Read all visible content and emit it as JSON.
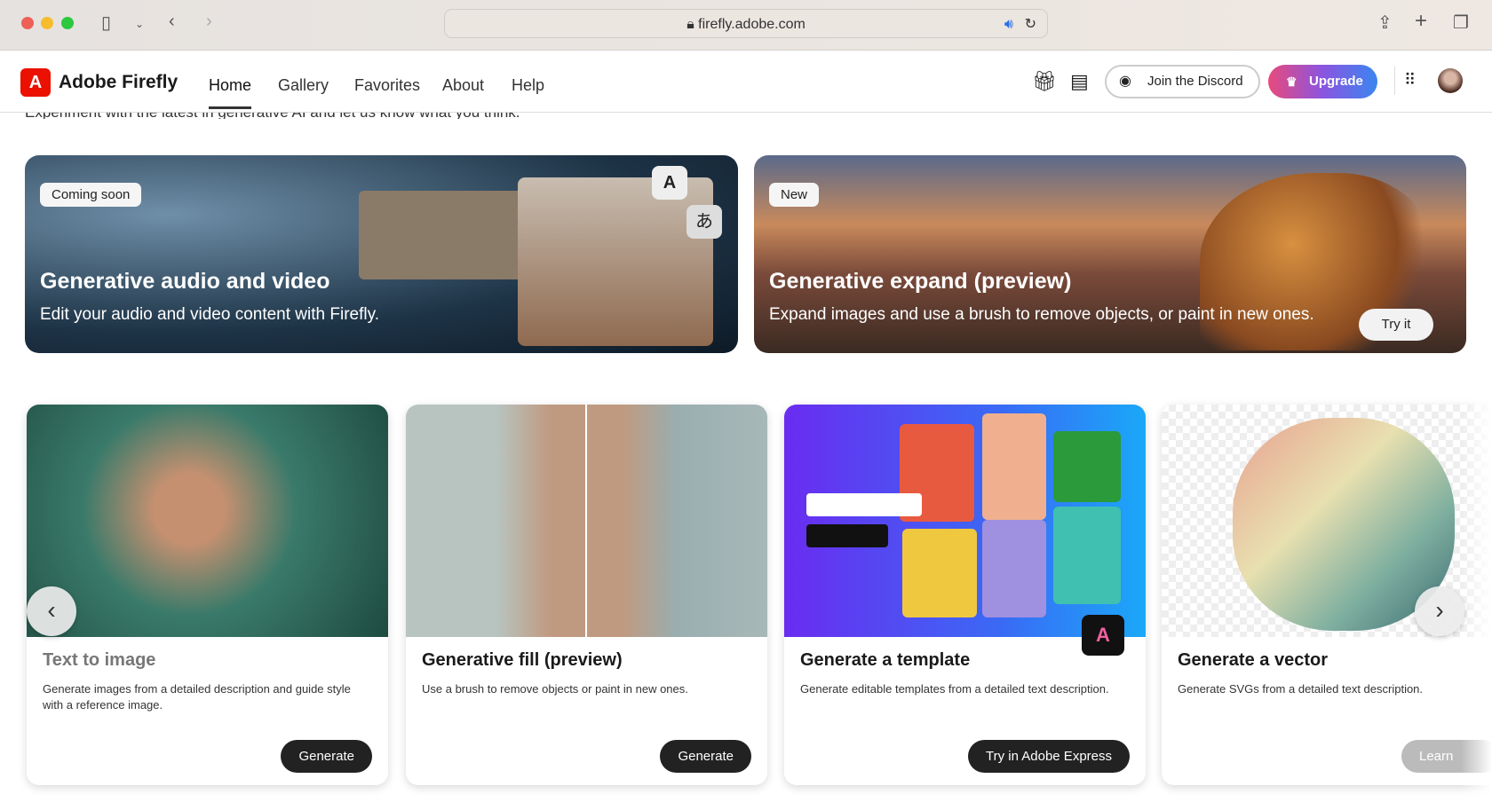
{
  "browser": {
    "url": "firefly.adobe.com"
  },
  "header": {
    "brand": "Adobe Firefly",
    "nav": [
      "Home",
      "Gallery",
      "Favorites",
      "About",
      "Help"
    ],
    "active": "Home",
    "discord": "Join the Discord",
    "upgrade": "Upgrade"
  },
  "intro": "Experiment with the latest in generative AI and let us know what you think.",
  "banners": [
    {
      "badge": "Coming soon",
      "title": "Generative audio and video",
      "desc": "Edit your audio and video content with Firefly."
    },
    {
      "badge": "New",
      "title": "Generative expand (preview)",
      "desc": "Expand images and use a brush to remove objects, or paint in new ones.",
      "button": "Try it"
    }
  ],
  "cards": [
    {
      "title": "Text to image",
      "desc": "Generate images from a detailed description and guide style with a reference image.",
      "button": "Generate"
    },
    {
      "title": "Generative fill (preview)",
      "desc": "Use a brush to remove objects or paint in new ones.",
      "button": "Generate"
    },
    {
      "title": "Generate a template",
      "desc": "Generate editable templates from a detailed text description.",
      "button": "Try in Adobe Express"
    },
    {
      "title": "Generate a vector",
      "desc": "Generate SVGs from a detailed text description.",
      "button": "Learn more"
    }
  ],
  "colors": {
    "brand": "#eb1000",
    "button": "#222222"
  }
}
